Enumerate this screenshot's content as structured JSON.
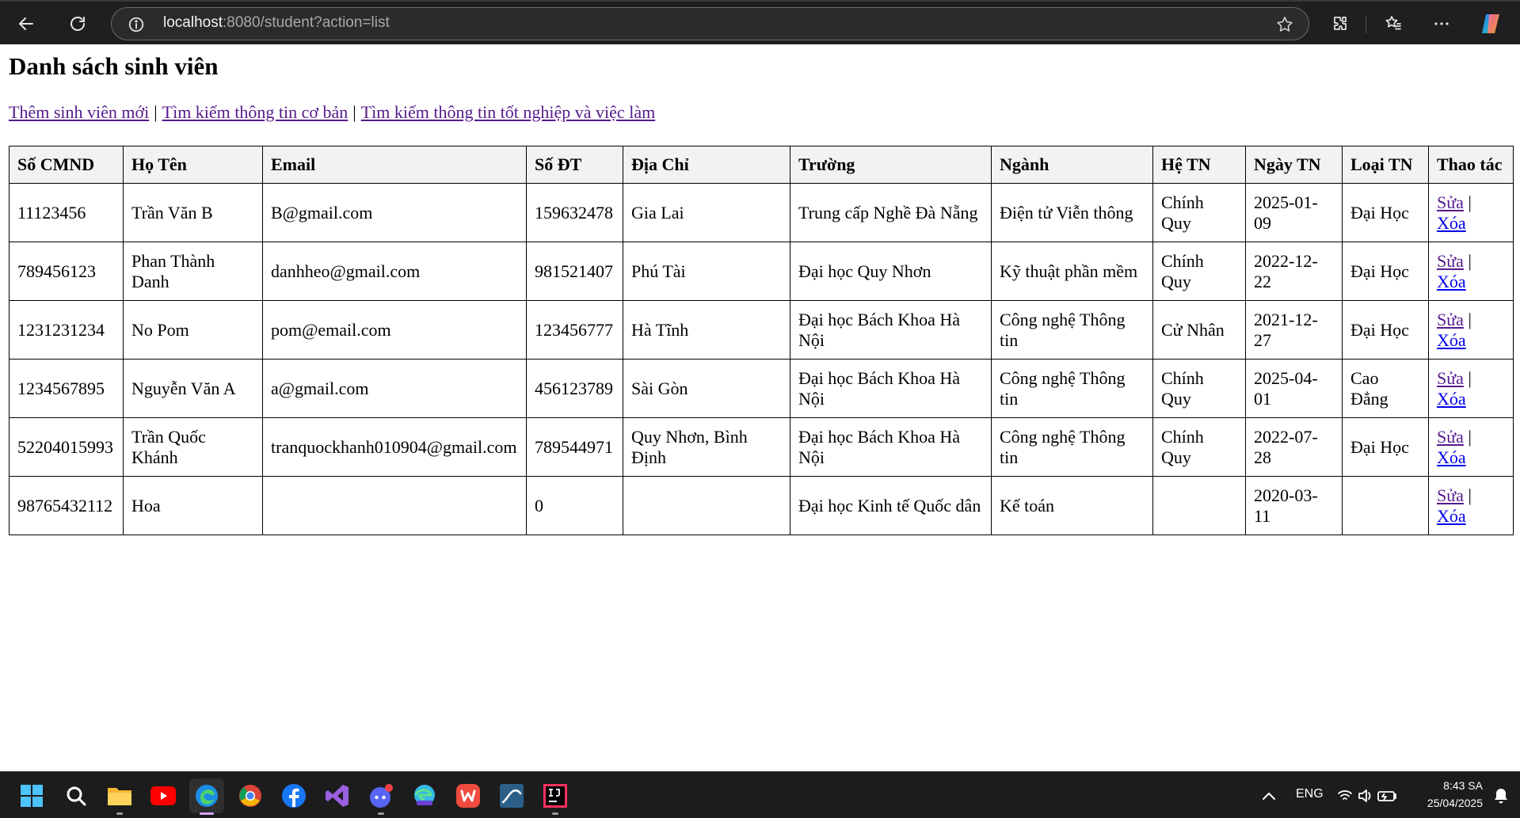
{
  "browser": {
    "url_host": "localhost",
    "url_rest": ":8080/student?action=list"
  },
  "page": {
    "title": "Danh sách sinh viên",
    "links": [
      "Thêm sinh viên mới",
      "Tìm kiếm thông tin cơ bản",
      "Tìm kiếm thông tin tốt nghiệp và việc làm"
    ],
    "separator": "|"
  },
  "table": {
    "headers": [
      "Số CMND",
      "Họ Tên",
      "Email",
      "Số ĐT",
      "Địa Chỉ",
      "Trường",
      "Ngành",
      "Hệ TN",
      "Ngày TN",
      "Loại TN",
      "Thao tác"
    ],
    "rows": [
      {
        "cmnd": "11123456",
        "name": "Trần Văn B",
        "email": "B@gmail.com",
        "phone": "159632478",
        "address": "Gia Lai",
        "school": "Trung cấp Nghề Đà Nẵng",
        "major": "Điện tử Viễn thông",
        "system": "Chính Quy",
        "date": "2025-01-09",
        "type": "Đại Học"
      },
      {
        "cmnd": "789456123",
        "name": "Phan Thành Danh",
        "email": "danhheo@gmail.com",
        "phone": "981521407",
        "address": "Phú Tài",
        "school": "Đại học Quy Nhơn",
        "major": "Kỹ thuật phần mềm",
        "system": "Chính Quy",
        "date": "2022-12-22",
        "type": "Đại Học"
      },
      {
        "cmnd": "1231231234",
        "name": "No Pom",
        "email": "pom@email.com",
        "phone": "123456777",
        "address": "Hà Tĩnh",
        "school": "Đại học Bách Khoa Hà Nội",
        "major": "Công nghệ Thông tin",
        "system": "Cử Nhân",
        "date": "2021-12-27",
        "type": "Đại Học"
      },
      {
        "cmnd": "1234567895",
        "name": "Nguyễn Văn A",
        "email": "a@gmail.com",
        "phone": "456123789",
        "address": "Sài Gòn",
        "school": "Đại học Bách Khoa Hà Nội",
        "major": "Công nghệ Thông tin",
        "system": "Chính Quy",
        "date": "2025-04-01",
        "type": "Cao Đẳng"
      },
      {
        "cmnd": "52204015993",
        "name": "Trần Quốc Khánh",
        "email": "tranquockhanh010904@gmail.com",
        "phone": "789544971",
        "address": "Quy Nhơn, Bình Định",
        "school": "Đại học Bách Khoa Hà Nội",
        "major": "Công nghệ Thông tin",
        "system": "Chính Quy",
        "date": "2022-07-28",
        "type": "Đại Học"
      },
      {
        "cmnd": "98765432112",
        "name": "Hoa",
        "email": "",
        "phone": "0",
        "address": "",
        "school": "Đại học Kinh tế Quốc dân",
        "major": "Kế toán",
        "system": "",
        "date": "2020-03-11",
        "type": ""
      }
    ],
    "edit_label": "Sửa",
    "delete_label": "Xóa",
    "action_sep": "|"
  },
  "taskbar": {
    "apps": [
      "windows-start",
      "search",
      "file-explorer",
      "youtube",
      "edge",
      "chrome",
      "facebook",
      "visual-studio",
      "discord",
      "edge-preview",
      "wps-office",
      "mysql-workbench",
      "intellij-idea"
    ],
    "language": "ENG",
    "time": "8:43 SA",
    "date": "25/04/2025"
  },
  "colors": {
    "link_visited": "#551a8b",
    "link": "#0000ee",
    "header_bg": "#f2f2f2",
    "chrome_bg": "#1f1f1f",
    "taskbar_bg": "#1c1c1c"
  }
}
